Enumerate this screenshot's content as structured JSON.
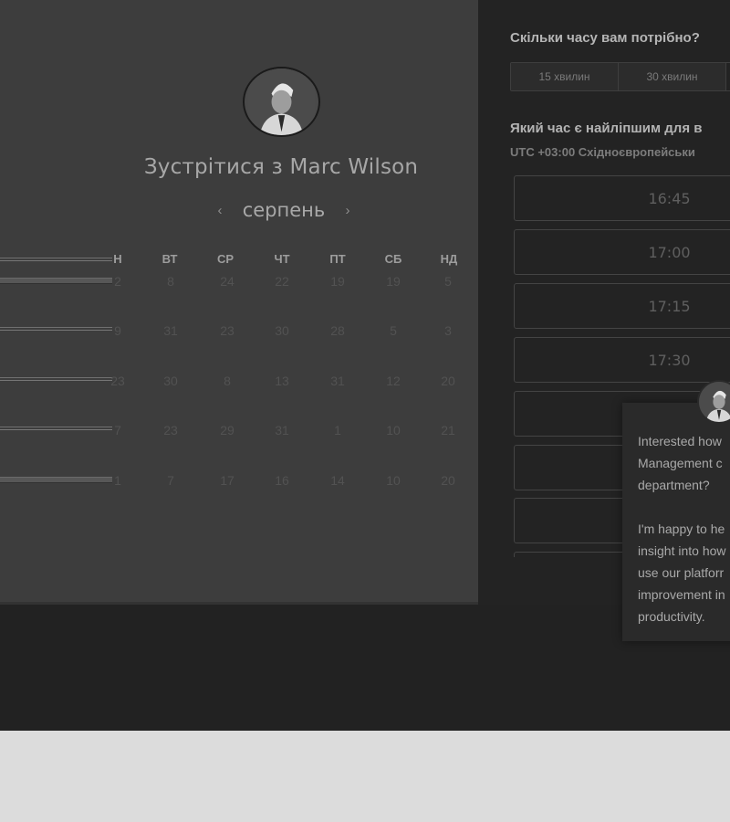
{
  "host": {
    "meet_title": "Зустрітися з Marc Wilson"
  },
  "calendar": {
    "month": "серпень",
    "prev_icon": "chevron-left-icon",
    "next_icon": "chevron-right-icon",
    "weekdays": [
      "Н",
      "ВТ",
      "СР",
      "ЧТ",
      "ПТ",
      "СБ",
      "НД"
    ],
    "weeks": [
      [
        "2",
        "8",
        "24",
        "22",
        "19",
        "19",
        "5"
      ],
      [
        "9",
        "31",
        "23",
        "30",
        "28",
        "5",
        "3"
      ],
      [
        "23",
        "30",
        "8",
        "13",
        "31",
        "12",
        "20"
      ],
      [
        "7",
        "23",
        "29",
        "31",
        "1",
        "10",
        "21"
      ],
      [
        "1",
        "7",
        "17",
        "16",
        "14",
        "10",
        "20"
      ]
    ]
  },
  "booking": {
    "duration_question": "Скільки часу вам потрібно?",
    "duration_options": [
      "15 хвилин",
      "30 хвилин"
    ],
    "best_time_question": "Який час є найліпшим для в",
    "timezone": "UTC +03:00 Східноєвропейськи",
    "time_slots": [
      "16:45",
      "17:00",
      "17:15",
      "17:30",
      "",
      "",
      "",
      ""
    ]
  },
  "chat": {
    "message": "Interested how\nManagement c\ndepartment?\n\nI'm happy to he\ninsight into how\nuse our platforr\nimprovement in\nproductivity."
  },
  "colors": {
    "app_background": "#222222",
    "calendar_panel": "#3d3d3d",
    "page_background": "#dcdcdc"
  }
}
